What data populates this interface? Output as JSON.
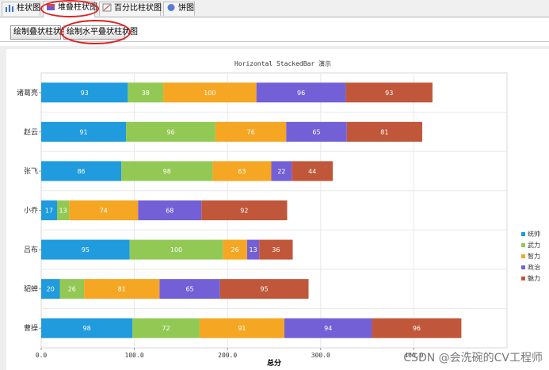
{
  "tabs": [
    {
      "label": "柱状图",
      "icon": "bar-chart-icon",
      "active": false
    },
    {
      "label": "堆叠柱状图",
      "icon": "stacked-bar-icon",
      "active": true
    },
    {
      "label": "百分比柱状图",
      "icon": "percent-bar-icon",
      "active": false
    },
    {
      "label": "饼图",
      "icon": "pie-chart-icon",
      "active": false
    }
  ],
  "toolbar": {
    "draw_stacked_label": "绘制叠状柱状图",
    "draw_horizontal_label": "绘制水平叠状柱状图"
  },
  "watermark": "CSDN @会洗碗的CV工程师",
  "colors": {
    "series": [
      "#1f9bde",
      "#92c955",
      "#f5a623",
      "#7460d6",
      "#c1573a"
    ],
    "annotation": "#e02020",
    "grid": "#e8e8e8"
  },
  "chart_data": {
    "type": "bar",
    "orientation": "horizontal",
    "stacked": true,
    "title": "Horizontal StackedBar 演示",
    "xlabel": "总分",
    "ylabel": "",
    "xlim": [
      0,
      500
    ],
    "xticks": [
      "0.0",
      "100.0",
      "200.0",
      "300.0",
      "400.0"
    ],
    "grid": true,
    "legend_position": "right",
    "show_value_labels": true,
    "categories": [
      "诸葛亮",
      "赵云",
      "张飞",
      "小乔",
      "吕布",
      "貂蝉",
      "曹操"
    ],
    "series": [
      {
        "name": "统帅",
        "values": [
          93,
          91,
          86,
          17,
          95,
          20,
          98
        ]
      },
      {
        "name": "武力",
        "values": [
          38,
          96,
          98,
          13,
          100,
          26,
          72
        ]
      },
      {
        "name": "智力",
        "values": [
          100,
          76,
          63,
          74,
          26,
          81,
          91
        ]
      },
      {
        "name": "政治",
        "values": [
          96,
          65,
          22,
          68,
          13,
          65,
          94
        ]
      },
      {
        "name": "魅力",
        "values": [
          93,
          81,
          44,
          92,
          36,
          95,
          96
        ]
      }
    ]
  }
}
